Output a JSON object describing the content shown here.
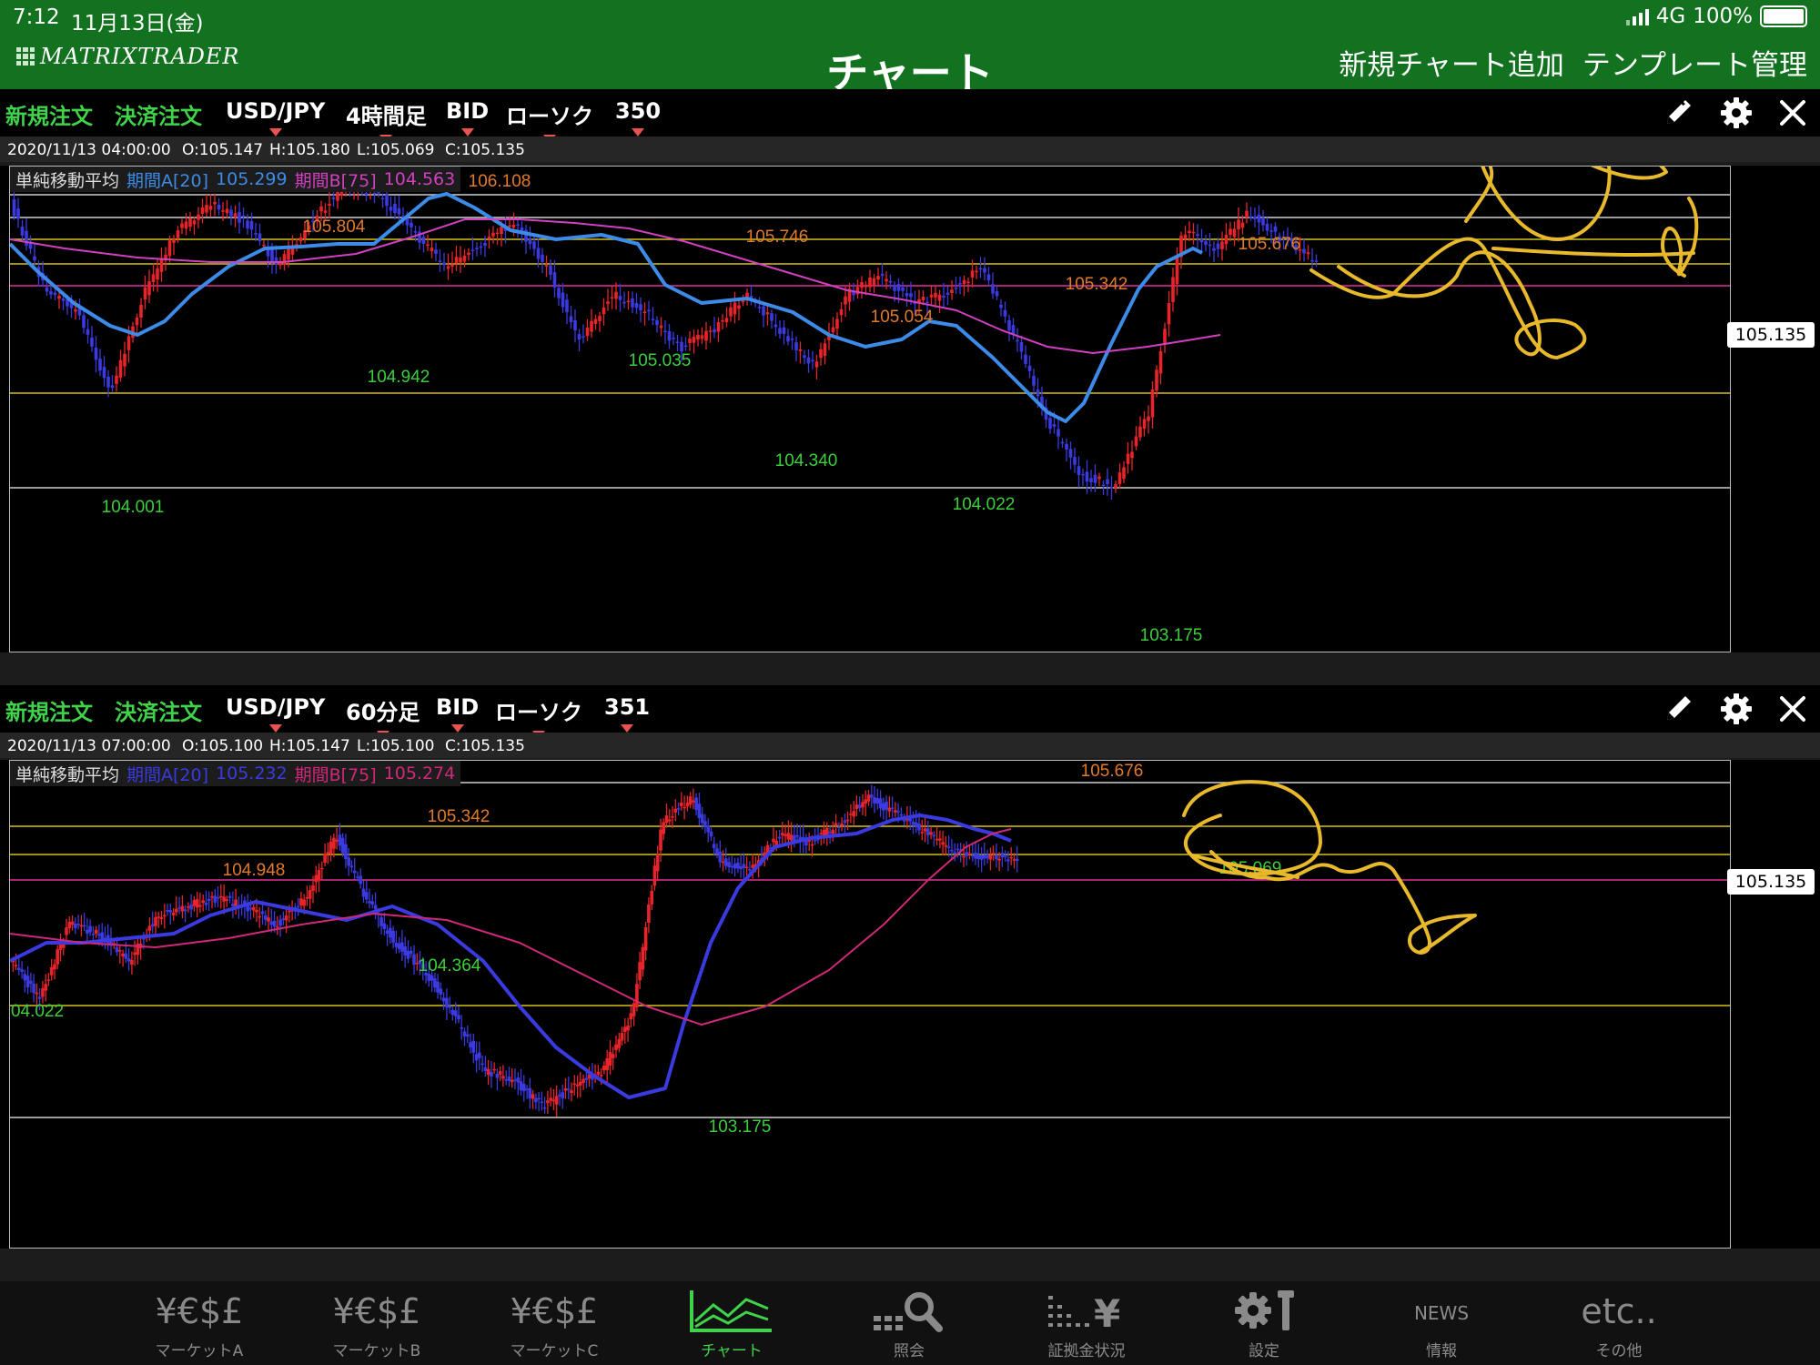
{
  "status": {
    "time": "7:12",
    "date": "11月13日(金)",
    "network": "4G",
    "battery": "100%"
  },
  "nav": {
    "logo": "MATRIXTRADER",
    "title": "チャート",
    "add_chart": "新規チャート追加",
    "template": "テンプレート管理"
  },
  "colors": {
    "accent": "#13721f",
    "up": "#e8242b",
    "down": "#3a3ae0",
    "ma_a": "#3d8be8",
    "ma_b": "#d040c0",
    "hline_yellow": "#d6c21c",
    "hline_magenta": "#e0309a"
  },
  "panels": [
    {
      "toolbar": {
        "new_order": "新規注文",
        "close_order": "決済注文",
        "pair": "USD/JPY",
        "timeframe": "4時間足",
        "price_type": "BID",
        "chart_type": "ローソク",
        "count": "350"
      },
      "info": {
        "datetime": "2020/11/13 04:00:00",
        "open": "O:105.147",
        "high": "H:105.180",
        "low": "L:105.069",
        "close": "C:105.135"
      },
      "legend": {
        "name": "単純移動平均",
        "a_label": "期間A[20]",
        "a_value": "105.299",
        "b_label": "期間B[75]",
        "b_value": "104.563"
      },
      "current_price": "105.135",
      "labels": [
        "106.108",
        "105.804",
        "105.746",
        "105.676",
        "105.342",
        "105.054",
        "104.942",
        "105.035",
        "104.340",
        "104.022",
        "104.001",
        "103.175"
      ]
    },
    {
      "toolbar": {
        "new_order": "新規注文",
        "close_order": "決済注文",
        "pair": "USD/JPY",
        "timeframe": "60分足",
        "price_type": "BID",
        "chart_type": "ローソク",
        "count": "351"
      },
      "info": {
        "datetime": "2020/11/13 07:00:00",
        "open": "O:105.100",
        "high": "H:105.147",
        "low": "L:105.100",
        "close": "C:105.135"
      },
      "legend": {
        "name": "単純移動平均",
        "a_label": "期間A[20]",
        "a_value": "105.232",
        "b_label": "期間B[75]",
        "b_value": "105.274"
      },
      "current_price": "105.135",
      "labels": [
        "105.676",
        "105.342",
        "104.948",
        "104.364",
        "04.022",
        "103.175",
        "105.069"
      ]
    }
  ],
  "tabs": [
    {
      "label": "マーケットA",
      "icon": "¥€$£"
    },
    {
      "label": "マーケットB",
      "icon": "¥€$£"
    },
    {
      "label": "マーケットC",
      "icon": "¥€$£"
    },
    {
      "label": "チャート",
      "icon": "chart-icon"
    },
    {
      "label": "照会",
      "icon": "search-icon"
    },
    {
      "label": "証拠金状況",
      "icon": "margin-icon"
    },
    {
      "label": "設定",
      "icon": "gear-icon"
    },
    {
      "label": "情報",
      "icon": "NEWS"
    },
    {
      "label": "その他",
      "icon": "etc.."
    }
  ]
}
